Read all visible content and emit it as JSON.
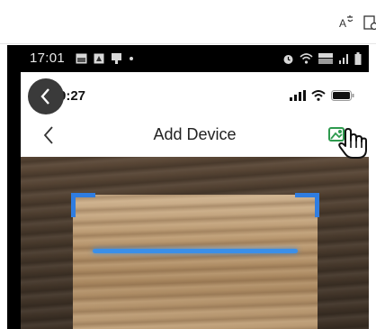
{
  "browser_toolbar": {
    "read_aloud_icon": "read-aloud-icon",
    "document_icon": "document-icon"
  },
  "android_status": {
    "time": "17:01",
    "icons_left": [
      "gallery-icon",
      "notification-icon",
      "settings-icon",
      "dot-icon"
    ],
    "icons_right": [
      "alarm-icon",
      "wifi-icon",
      "volte-icon",
      "signal-icon",
      "battery-icon"
    ]
  },
  "ios_status": {
    "time": "9:27"
  },
  "nav": {
    "title": "Add Device"
  },
  "colors": {
    "scan_accent": "#2f7de1",
    "gallery_icon": "#2e9a4e"
  }
}
